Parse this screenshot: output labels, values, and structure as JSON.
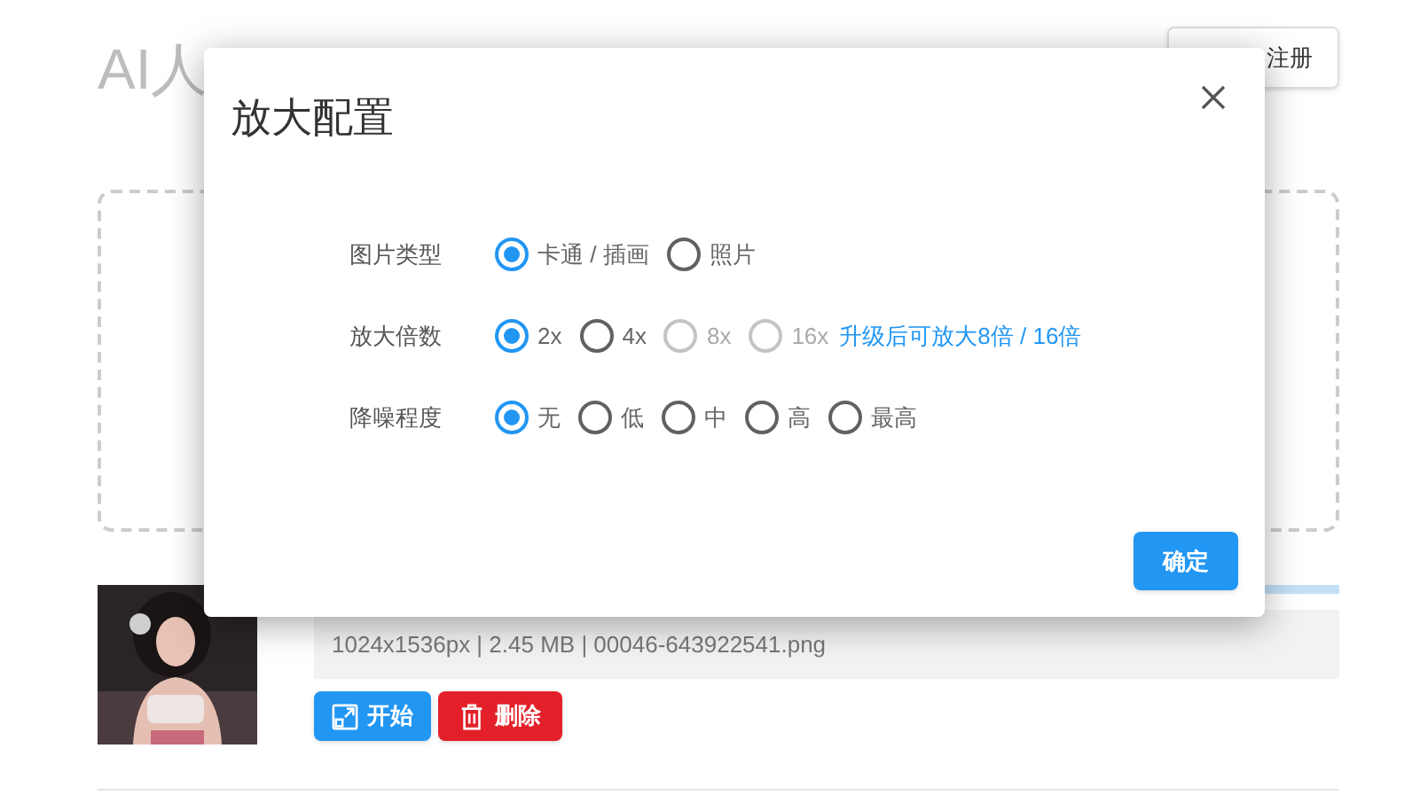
{
  "page": {
    "title": "AI人",
    "register_button": "注册"
  },
  "file": {
    "upload_progress": {
      "level": 1
    },
    "info": "1024x1536px | 2.45 MB | 00046-643922541.png",
    "start_button": "开始",
    "delete_button": "删除"
  },
  "dialog": {
    "title": "放大配置",
    "fields": [
      {
        "label": "图片类型",
        "options": [
          {
            "label": "卡通 / 插画",
            "selected": true,
            "disabled": false
          },
          {
            "label": "照片",
            "selected": false,
            "disabled": false
          }
        ]
      },
      {
        "label": "放大倍数",
        "options": [
          {
            "label": "2x",
            "selected": true,
            "disabled": false
          },
          {
            "label": "4x",
            "selected": false,
            "disabled": false
          },
          {
            "label": "8x",
            "selected": false,
            "disabled": true
          },
          {
            "label": "16x",
            "selected": false,
            "disabled": true
          }
        ],
        "note": "升级后可放大8倍 / 16倍"
      },
      {
        "label": "降噪程度",
        "options": [
          {
            "label": "无",
            "selected": true,
            "disabled": false
          },
          {
            "label": "低",
            "selected": false,
            "disabled": false
          },
          {
            "label": "中",
            "selected": false,
            "disabled": false
          },
          {
            "label": "高",
            "selected": false,
            "disabled": false
          },
          {
            "label": "最高",
            "selected": false,
            "disabled": false
          }
        ]
      }
    ],
    "confirm_button": "确定"
  }
}
